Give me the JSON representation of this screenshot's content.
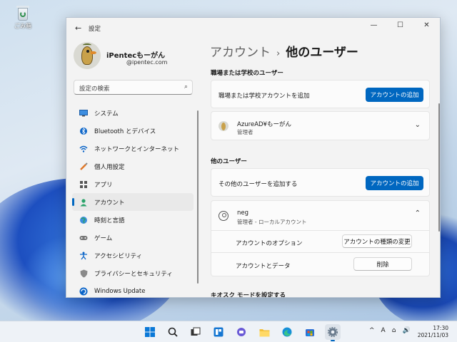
{
  "desktop": {
    "recycle_bin_label": "ごみ箱"
  },
  "window": {
    "title": "設定",
    "minimize": "—",
    "maximize": "☐",
    "close": "✕"
  },
  "profile": {
    "name": "iPentecもーがん",
    "email": "@ipentec.com"
  },
  "search": {
    "placeholder": "設定の検索"
  },
  "nav": {
    "items": [
      {
        "label": "システム",
        "icon": "monitor-icon"
      },
      {
        "label": "Bluetooth とデバイス",
        "icon": "bluetooth-icon"
      },
      {
        "label": "ネットワークとインターネット",
        "icon": "wifi-icon"
      },
      {
        "label": "個人用設定",
        "icon": "brush-icon"
      },
      {
        "label": "アプリ",
        "icon": "apps-icon"
      },
      {
        "label": "アカウント",
        "icon": "account-icon",
        "active": true
      },
      {
        "label": "時刻と言語",
        "icon": "globe-icon"
      },
      {
        "label": "ゲーム",
        "icon": "gamepad-icon"
      },
      {
        "label": "アクセシビリティ",
        "icon": "accessibility-icon"
      },
      {
        "label": "プライバシーとセキュリティ",
        "icon": "shield-icon"
      },
      {
        "label": "Windows Update",
        "icon": "update-icon"
      }
    ]
  },
  "header": {
    "breadcrumb": "アカウント",
    "separator": "›",
    "current": "他のユーザー"
  },
  "work_section": {
    "title": "職場または学校のユーザー",
    "add_row_text": "職場または学校アカウントを追加",
    "add_button": "アカウントの追加",
    "user": {
      "name": "AzureAD¥もーがん",
      "role": "管理者"
    }
  },
  "other_section": {
    "title": "他のユーザー",
    "add_row_text": "その他のユーザーを追加する",
    "add_button": "アカウントの追加",
    "user": {
      "name": "neg",
      "role": "管理者 - ローカルアカウント"
    },
    "options_label": "アカウントのオプション",
    "change_type_button": "アカウントの種類の変更",
    "data_label": "アカウントとデータ",
    "delete_button": "削除"
  },
  "kiosk_section": {
    "title": "キオスク モードを設定する"
  },
  "taskbar": {
    "icons": [
      "windows-start-icon",
      "search-icon",
      "task-view-icon",
      "widgets-icon",
      "chat-icon",
      "file-explorer-icon",
      "edge-icon",
      "store-icon",
      "settings-icon"
    ],
    "tray": {
      "chevron": "^",
      "ime": "A",
      "network": "⌂",
      "volume": "🔊"
    },
    "time": "17:30",
    "date": "2021/11/03"
  }
}
